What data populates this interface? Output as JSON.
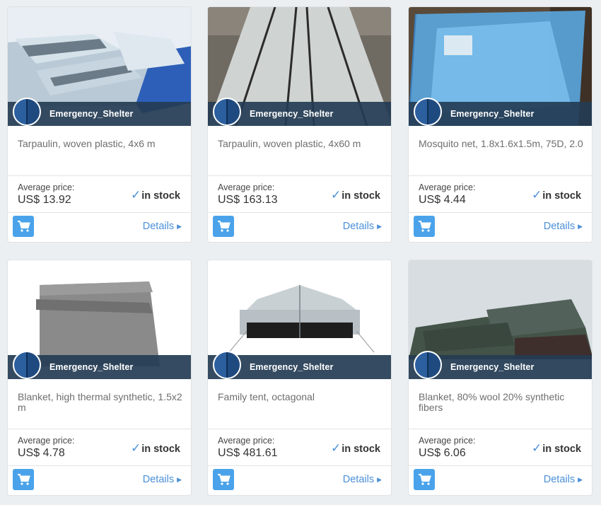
{
  "products": [
    {
      "category": "Emergency_Shelter",
      "title": "Tarpaulin, woven plastic, 4x6 m",
      "price_label": "Average price:",
      "price": "US$ 13.92",
      "stock": "in stock",
      "details": "Details",
      "image": "tarpaulin-stack-photo"
    },
    {
      "category": "Emergency_Shelter",
      "title": "Tarpaulin, woven plastic, 4x60 m",
      "price_label": "Average price:",
      "price": "US$ 163.13",
      "stock": "in stock",
      "details": "Details",
      "image": "tarpaulin-roll-photo"
    },
    {
      "category": "Emergency_Shelter",
      "title": "Mosquito net, 1.8x1.6x1.5m, 75D, 2.0",
      "price_label": "Average price:",
      "price": "US$ 4.44",
      "stock": "in stock",
      "details": "Details",
      "image": "mosquito-net-photo"
    },
    {
      "category": "Emergency_Shelter",
      "title": "Blanket, high thermal synthetic, 1.5x2 m",
      "price_label": "Average price:",
      "price": "US$ 4.78",
      "stock": "in stock",
      "details": "Details",
      "image": "grey-blanket-photo"
    },
    {
      "category": "Emergency_Shelter",
      "title": "Family tent, octagonal",
      "price_label": "Average price:",
      "price": "US$ 481.61",
      "stock": "in stock",
      "details": "Details",
      "image": "family-tent-photo"
    },
    {
      "category": "Emergency_Shelter",
      "title": "Blanket, 80% wool 20% synthetic fibers",
      "price_label": "Average price:",
      "price": "US$ 6.06",
      "stock": "in stock",
      "details": "Details",
      "image": "wool-blankets-photo"
    }
  ],
  "icons": {
    "cart": "shopping-cart-icon",
    "check": "checkmark-icon",
    "badge": "category-badge-icon",
    "arrow": "caret-right-icon"
  },
  "colors": {
    "accent": "#4a90d9",
    "cart_button": "#4aa3ea",
    "category_band": "#243c54",
    "page_background": "#eceff1"
  }
}
